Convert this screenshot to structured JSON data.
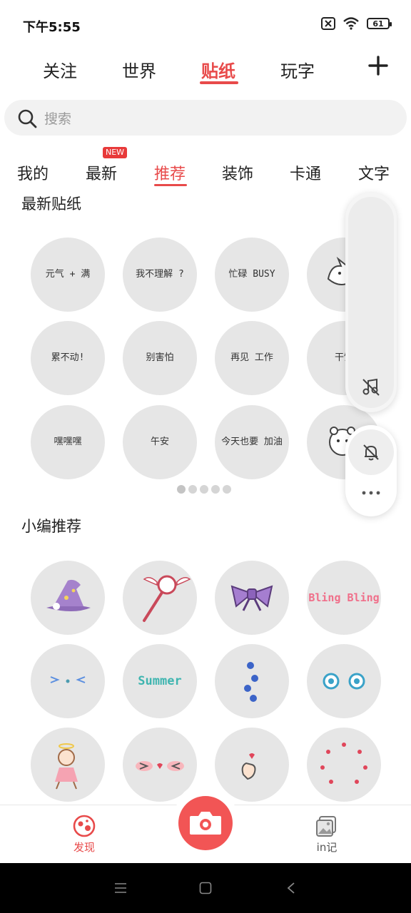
{
  "status": {
    "time": "下午5:55",
    "battery": "61"
  },
  "top_tabs": [
    "关注",
    "世界",
    "贴纸",
    "玩字"
  ],
  "search": {
    "placeholder": "搜索"
  },
  "categories": [
    "我的",
    "最新",
    "推荐",
    "装饰",
    "卡通",
    "文字"
  ],
  "new_badge": "NEW",
  "sections": {
    "latest": "最新贴纸",
    "editor": "小编推荐"
  },
  "latest_stickers": [
    "元气 + 满",
    "我不理解 ?",
    "忙碌 BUSY",
    "",
    "累不动!",
    "别害怕",
    "再见 工作",
    "干饭",
    "嘿嘿嘿",
    "午安",
    "今天也要 加油",
    ""
  ],
  "editor_stickers": [
    "",
    "",
    "",
    "Bling Bling",
    "",
    "Summer",
    "",
    "",
    "",
    "",
    "",
    ""
  ],
  "bottom_nav": {
    "discover": "发现",
    "record": "in记"
  },
  "colors": {
    "accent": "#e84a4a"
  }
}
